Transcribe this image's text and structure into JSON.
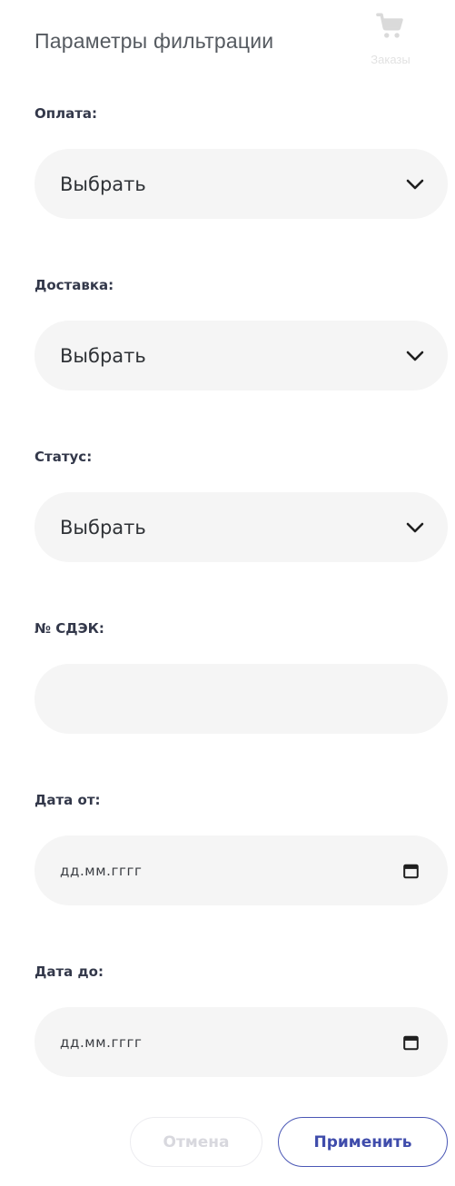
{
  "header": {
    "title": "Параметры фильтрации",
    "nav_item_label": "Заказы",
    "nav_item_icon": "cart-icon"
  },
  "filters": {
    "payment": {
      "label": "Оплата:",
      "value": "Выбрать"
    },
    "delivery": {
      "label": "Доставка:",
      "value": "Выбрать"
    },
    "status": {
      "label": "Статус:",
      "value": "Выбрать"
    },
    "cdek": {
      "label": "№ СДЭК:",
      "value": ""
    },
    "date_from": {
      "label": "Дата от:",
      "placeholder": "дд.мм.гггг"
    },
    "date_to": {
      "label": "Дата до:",
      "placeholder": "дд.мм.гггг"
    }
  },
  "actions": {
    "cancel_label": "Отмена",
    "apply_label": "Применить"
  },
  "colors": {
    "field_bg": "#f5f5f5",
    "accent": "#4a57b5",
    "label": "#33384a"
  }
}
